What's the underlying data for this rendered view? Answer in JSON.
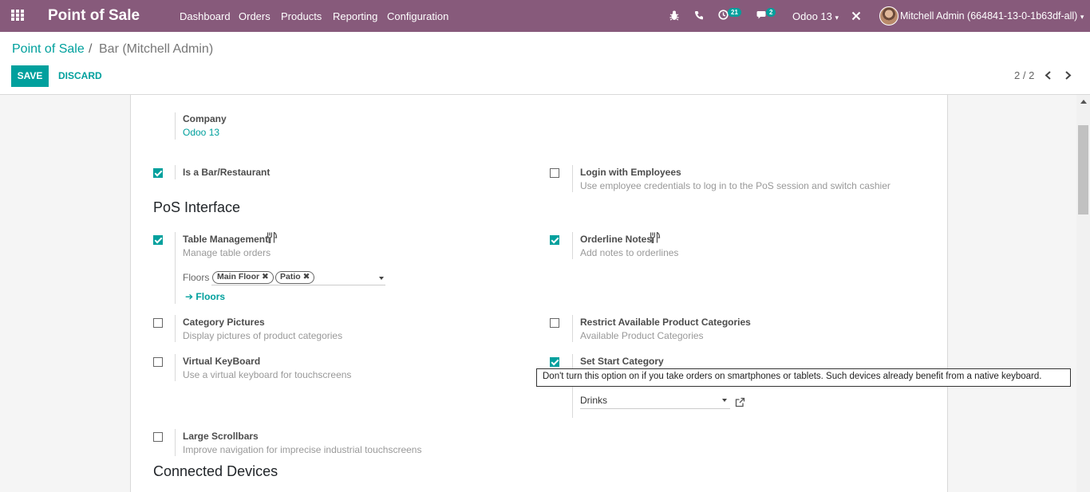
{
  "navbar": {
    "brand": "Point of Sale",
    "menu": [
      "Dashboard",
      "Orders",
      "Products",
      "Reporting",
      "Configuration"
    ],
    "activity_count": "21",
    "message_count": "2",
    "company": "Odoo 13",
    "user": "Mitchell Admin (664841-13-0-1b63df-all)"
  },
  "breadcrumb": {
    "root": "Point of Sale",
    "sep": "/",
    "current": "Bar (Mitchell Admin)"
  },
  "actions": {
    "save": "SAVE",
    "discard": "DISCARD"
  },
  "pager": {
    "text": "2 / 2"
  },
  "form": {
    "company_label": "Company",
    "company_value": "Odoo 13",
    "is_bar": {
      "label": "Is a Bar/Restaurant",
      "checked": true
    },
    "login_employees": {
      "label": "Login with Employees",
      "desc": "Use employee credentials to log in to the PoS session and switch cashier",
      "checked": false
    },
    "section_pos_interface": "PoS Interface",
    "table_management": {
      "label": "Table Management",
      "desc": "Manage table orders",
      "checked": true
    },
    "floors_label": "Floors",
    "floors": [
      "Main Floor",
      "Patio"
    ],
    "floors_link": "Floors",
    "orderline_notes": {
      "label": "Orderline Notes",
      "desc": "Add notes to orderlines",
      "checked": true
    },
    "category_pictures": {
      "label": "Category Pictures",
      "desc": "Display pictures of product categories",
      "checked": false
    },
    "restrict_categories": {
      "label": "Restrict Available Product Categories",
      "desc": "Available Product Categories",
      "checked": false
    },
    "virtual_keyboard": {
      "label": "Virtual KeyBoard",
      "desc": "Use a virtual keyboard for touchscreens",
      "checked": false
    },
    "start_category": {
      "label": "Set Start Category",
      "value": "Drinks",
      "checked": true
    },
    "large_scrollbars": {
      "label": "Large Scrollbars",
      "desc": "Improve navigation for imprecise industrial touchscreens",
      "checked": false
    },
    "section_connected_devices": "Connected Devices"
  },
  "tooltip": "Don't turn this option on if you take orders on smartphones or tablets. Such devices already benefit from a native keyboard.",
  "colors": {
    "brand": "#875a7b",
    "accent": "#00a09d"
  }
}
